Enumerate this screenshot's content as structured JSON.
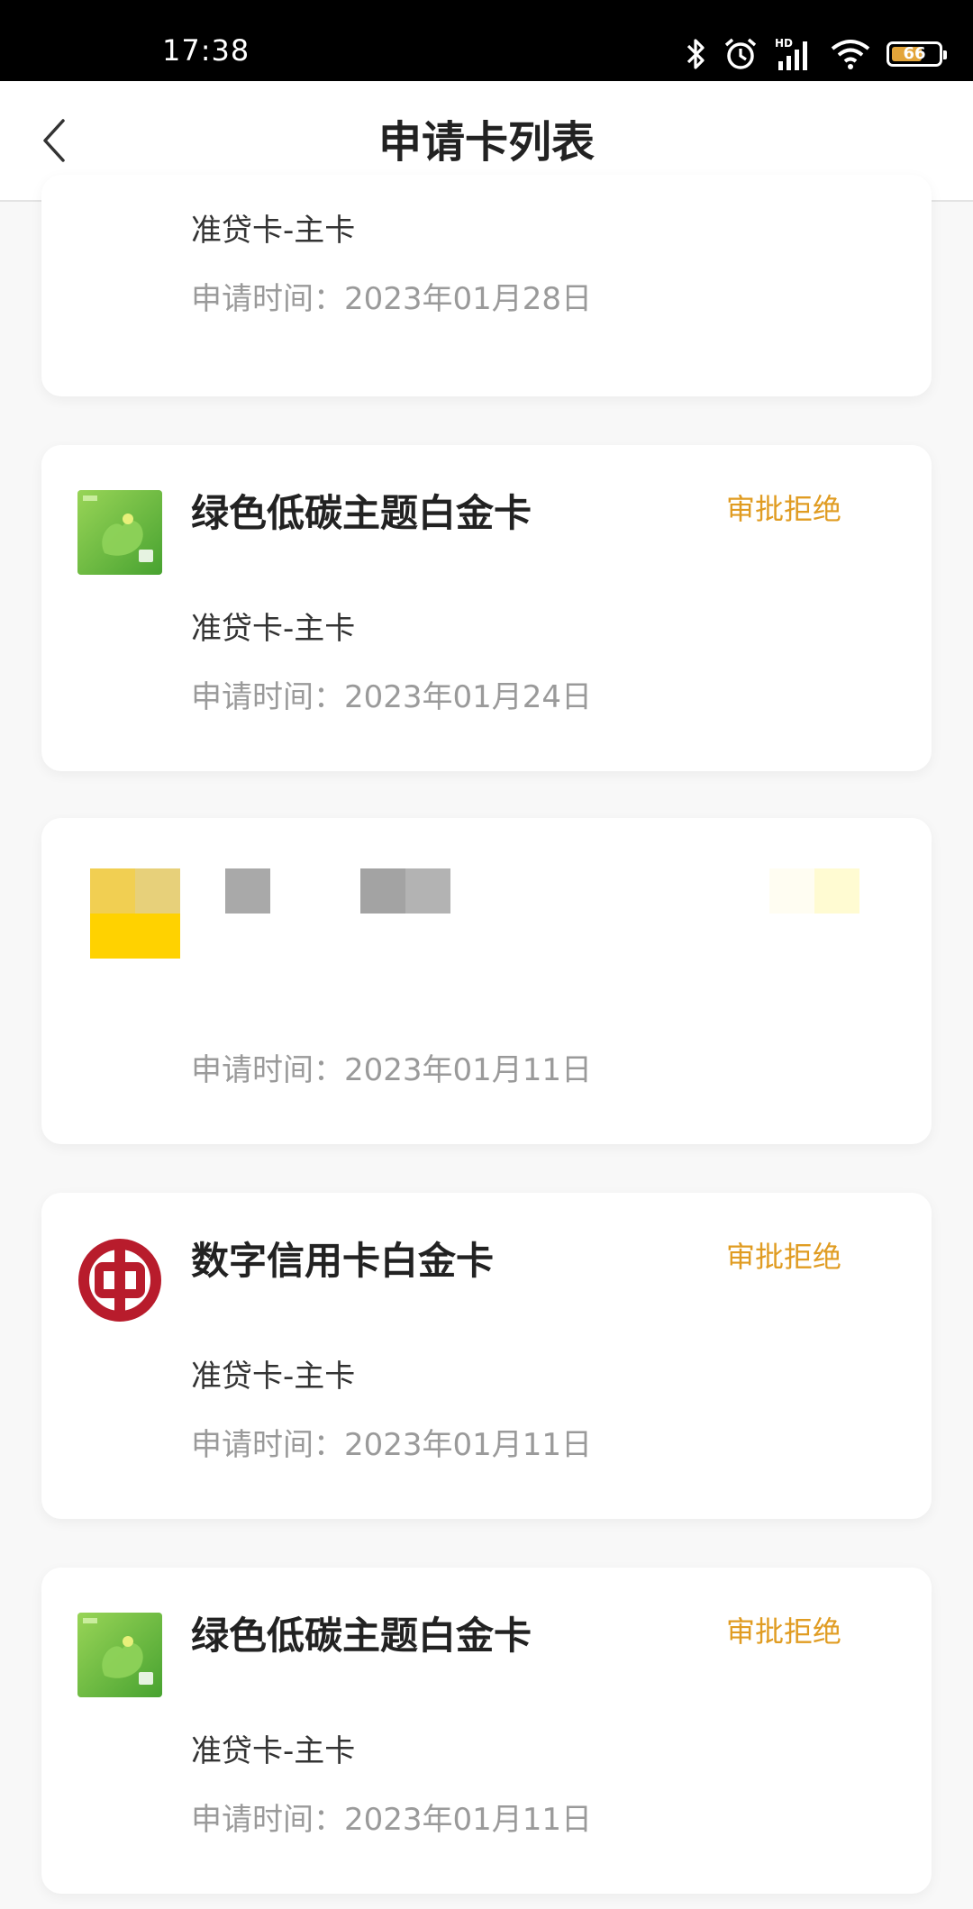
{
  "statusbar": {
    "time": "17:38",
    "battery": "66",
    "battery_level": 0.66,
    "network": "HD"
  },
  "nav": {
    "title": "申请卡列表"
  },
  "cards": [
    {
      "name": "",
      "status": "",
      "type": "准贷卡-主卡",
      "date": "申请时间：2023年01月28日",
      "logo": "none"
    },
    {
      "name": "绿色低碳主题白金卡",
      "status": "审批拒绝",
      "type": "准贷卡-主卡",
      "date": "申请时间：2023年01月24日",
      "logo": "green-card-icon"
    },
    {
      "name": "",
      "status": "",
      "type": "",
      "date": "申请时间：2023年01月11日",
      "logo": "pixelated"
    },
    {
      "name": "数字信用卡白金卡",
      "status": "审批拒绝",
      "type": "准贷卡-主卡",
      "date": "申请时间：2023年01月11日",
      "logo": "bank-of-china-icon"
    },
    {
      "name": "绿色低碳主题白金卡",
      "status": "审批拒绝",
      "type": "准贷卡-主卡",
      "date": "申请时间：2023年01月11日",
      "logo": "green-card-icon"
    }
  ],
  "colors": {
    "accent": "#e09c22",
    "boc_red": "#b81c2c",
    "green_card": "#6cbf3a"
  }
}
